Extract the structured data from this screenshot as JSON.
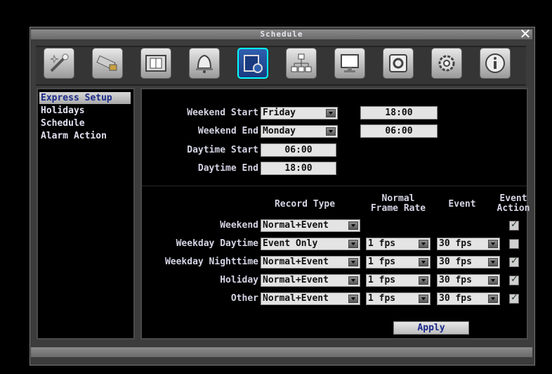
{
  "window": {
    "title": "Schedule"
  },
  "toolbar": {
    "icons": [
      "wand-icon",
      "camera-icon",
      "film-icon",
      "alarm-bell-icon",
      "schedule-icon",
      "network-icon",
      "display-icon",
      "backup-disk-icon",
      "gear-icon",
      "info-icon"
    ],
    "active_index": 4
  },
  "sidebar": {
    "items": [
      {
        "label": "Express Setup",
        "selected": true
      },
      {
        "label": "Holidays",
        "selected": false
      },
      {
        "label": "Schedule",
        "selected": false
      },
      {
        "label": "Alarm Action",
        "selected": false
      }
    ]
  },
  "weekend": {
    "start_label": "Weekend Start",
    "start_day": "Friday",
    "start_time": "18:00",
    "end_label": "Weekend End",
    "end_day": "Monday",
    "end_time": "06:00"
  },
  "daytime": {
    "start_label": "Daytime Start",
    "start_time": "06:00",
    "end_label": "Daytime End",
    "end_time": "18:00"
  },
  "table": {
    "headers": {
      "record_type": "Record Type",
      "normal_frame_rate_1": "Normal",
      "normal_frame_rate_2": "Frame Rate",
      "event": "Event",
      "event_action_1": "Event",
      "event_action_2": "Action"
    },
    "rows": [
      {
        "label": "Weekend",
        "record_type": "Normal+Event",
        "normal_fps": "",
        "event_fps": "",
        "action": true
      },
      {
        "label": "Weekday Daytime",
        "record_type": "Event Only",
        "normal_fps": "1 fps",
        "event_fps": "30 fps",
        "action": false
      },
      {
        "label": "Weekday Nighttime",
        "record_type": "Normal+Event",
        "normal_fps": "1 fps",
        "event_fps": "30 fps",
        "action": true
      },
      {
        "label": "Holiday",
        "record_type": "Normal+Event",
        "normal_fps": "1 fps",
        "event_fps": "30 fps",
        "action": true
      },
      {
        "label": "Other",
        "record_type": "Normal+Event",
        "normal_fps": "1 fps",
        "event_fps": "30 fps",
        "action": true
      }
    ]
  },
  "apply_label": "Apply",
  "close_glyph": "✕",
  "colors": {
    "selected_text": "#1a2a8a",
    "active_tool": "#2f5fb0",
    "active_border": "#00ffff"
  }
}
